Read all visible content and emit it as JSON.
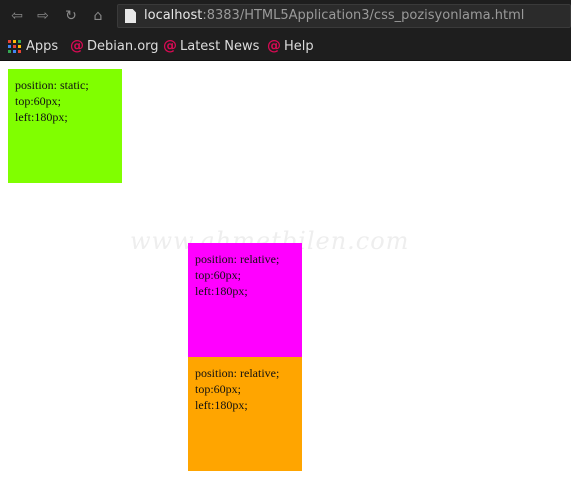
{
  "toolbar": {
    "back_icon": "back-arrow-icon",
    "forward_icon": "forward-arrow-icon",
    "reload_icon": "reload-icon",
    "home_icon": "home-icon",
    "url_host": "localhost",
    "url_rest": ":8383/HTML5Application3/css_pozisyonlama.html"
  },
  "bookmarks": {
    "items": [
      {
        "label": "Apps",
        "icon": "apps-grid-icon"
      },
      {
        "label": "Debian.org",
        "icon": "debian-swirl-icon"
      },
      {
        "label": "Latest News",
        "icon": "debian-swirl-icon"
      },
      {
        "label": "Help",
        "icon": "debian-swirl-icon"
      }
    ]
  },
  "boxes": [
    {
      "line1": "position: static;",
      "line2": "top:60px;",
      "line3": "left:180px;",
      "color": "#80ff00"
    },
    {
      "line1": "position: relative;",
      "line2": "top:60px;",
      "line3": "left:180px;",
      "color": "#ff00ff"
    },
    {
      "line1": "position: relative;",
      "line2": "top:60px;",
      "line3": "left:180px;",
      "color": "#ffa500"
    }
  ],
  "watermark": "www.ahmetbilen.com",
  "colors": {
    "chrome_bg": "#1e1e1e",
    "debian_red": "#d70a53"
  }
}
